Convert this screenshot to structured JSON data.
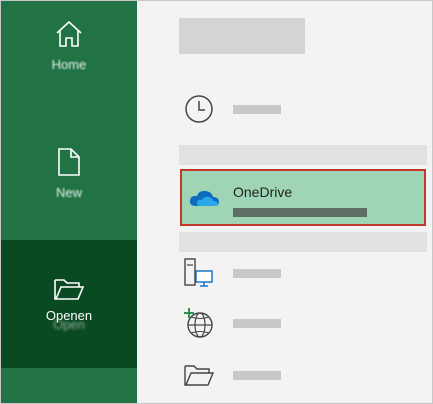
{
  "sidebar": {
    "home": {
      "label": "Home",
      "icon": "home-icon"
    },
    "new": {
      "label": "New",
      "icon": "new-document-icon"
    },
    "open": {
      "label_primary": "Openen",
      "label_secondary": "Open",
      "icon": "open-folder-icon"
    }
  },
  "main": {
    "recent_icon": "clock-icon",
    "onedrive": {
      "title": "OneDrive",
      "icon": "onedrive-cloud-icon"
    },
    "other_locations": [
      {
        "icon": "this-pc-icon"
      },
      {
        "icon": "add-place-globe-icon"
      },
      {
        "icon": "browse-folder-icon"
      }
    ]
  },
  "colors": {
    "sidebar_green": "#217346",
    "sidebar_selected": "#0a4a23",
    "highlight_green": "#9fd5b5",
    "highlight_border": "#c0392b",
    "onedrive_blue": "#0f6cbd"
  }
}
